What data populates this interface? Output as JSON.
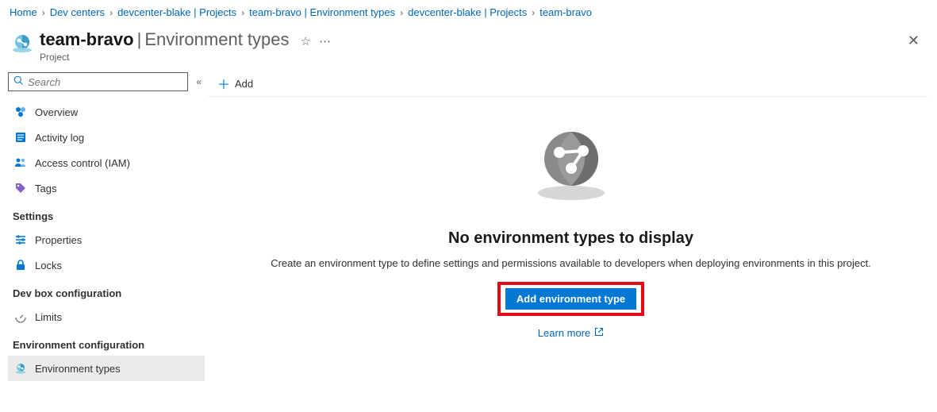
{
  "breadcrumb": [
    {
      "label": "Home"
    },
    {
      "label": "Dev centers"
    },
    {
      "label": "devcenter-blake | Projects"
    },
    {
      "label": "team-bravo | Environment types"
    },
    {
      "label": "devcenter-blake | Projects"
    },
    {
      "label": "team-bravo"
    }
  ],
  "header": {
    "name": "team-bravo",
    "section": "Environment types",
    "subtitle": "Project"
  },
  "sidebar": {
    "search_placeholder": "Search",
    "items_top": [
      {
        "label": "Overview"
      },
      {
        "label": "Activity log"
      },
      {
        "label": "Access control (IAM)"
      },
      {
        "label": "Tags"
      }
    ],
    "section_settings": "Settings",
    "items_settings": [
      {
        "label": "Properties"
      },
      {
        "label": "Locks"
      }
    ],
    "section_devbox": "Dev box configuration",
    "items_devbox": [
      {
        "label": "Limits"
      }
    ],
    "section_env": "Environment configuration",
    "items_env": [
      {
        "label": "Environment types"
      }
    ]
  },
  "toolbar": {
    "add_label": "Add"
  },
  "empty": {
    "title": "No environment types to display",
    "desc": "Create an environment type to define settings and permissions available to developers when deploying environments in this project.",
    "button": "Add environment type",
    "learn_more": "Learn more"
  }
}
